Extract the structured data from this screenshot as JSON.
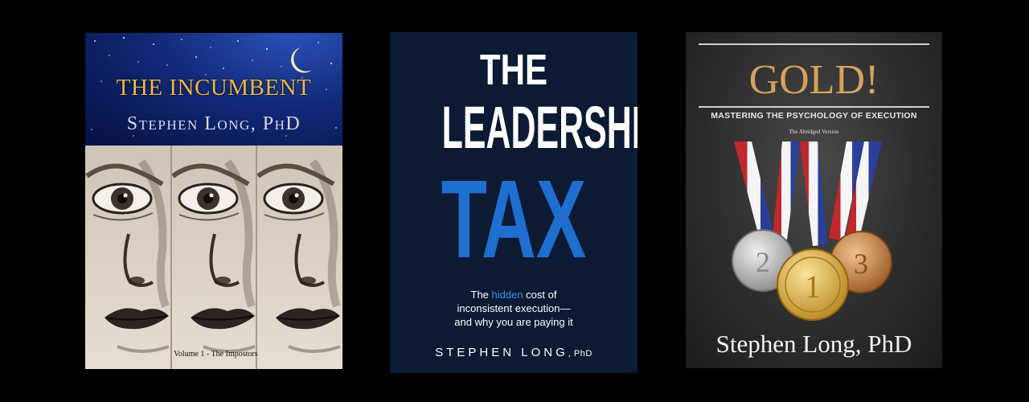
{
  "books": [
    {
      "title": "THE INCUMBENT",
      "author": "Stephen Long, PhD",
      "volume": "Volume 1 - The Impostors",
      "colors": {
        "sky": "#122a7a",
        "title": "#e8b84a",
        "author": "#d8dcf0"
      }
    },
    {
      "title_the": "THE",
      "title_main": "LEADERSHIP",
      "title_tax": "TAX",
      "subtitle_pre": "The ",
      "subtitle_highlight": "hidden",
      "subtitle_post": " cost of",
      "subtitle_line2": "inconsistent execution—",
      "subtitle_line3": "and why you are paying it",
      "author": "STEPHEN LONG",
      "author_suffix": ", PhD",
      "colors": {
        "background": "#0c1a33",
        "accent": "#1e6fd0"
      }
    },
    {
      "title": "GOLD!",
      "subtitle": "MASTERING THE PSYCHOLOGY OF EXECUTION",
      "edition": "The Abridged Version",
      "medal_numbers": [
        "2",
        "1",
        "3"
      ],
      "author": "Stephen Long, PhD",
      "colors": {
        "title": "#d6a25c",
        "background": "#2b2b2b"
      }
    }
  ]
}
